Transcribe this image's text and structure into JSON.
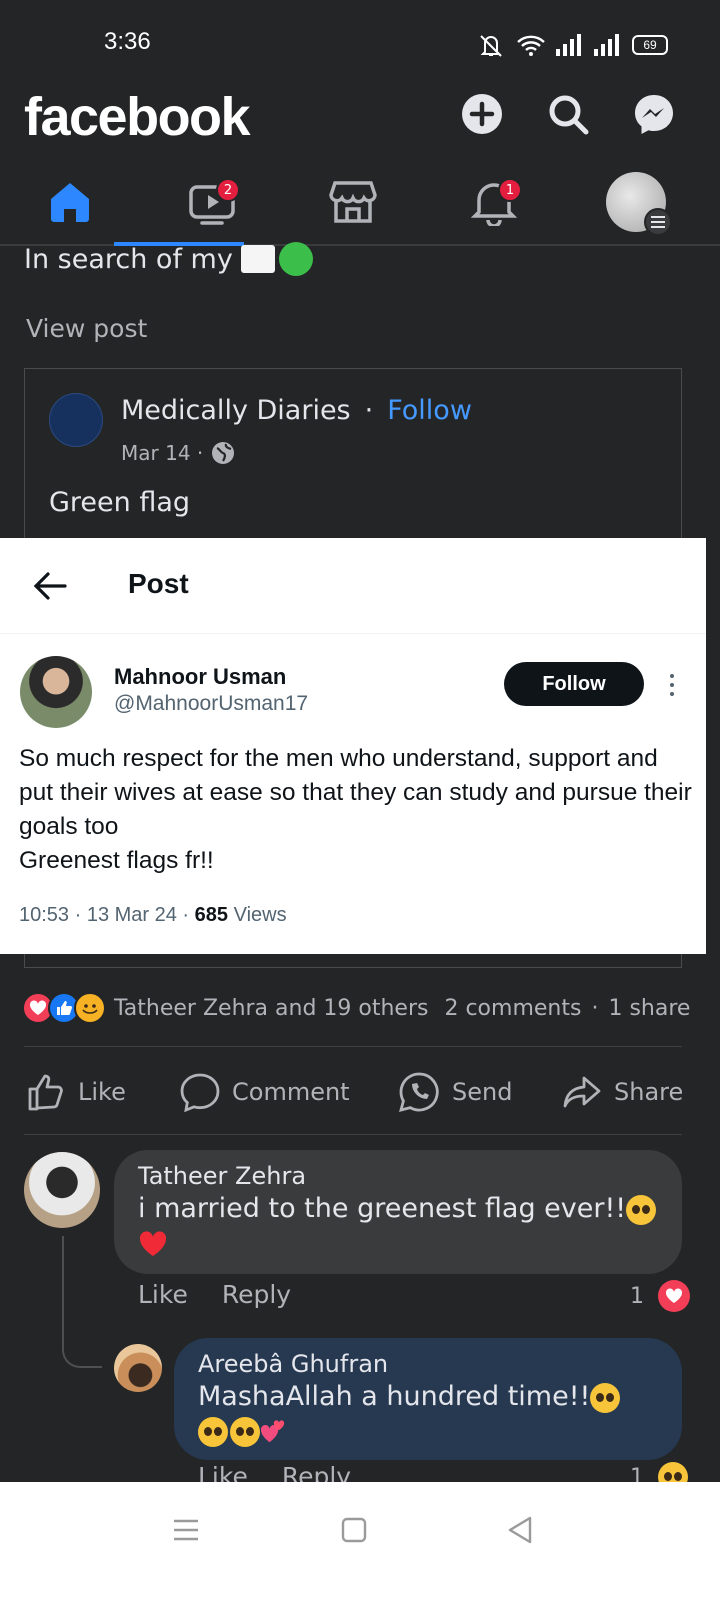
{
  "status_bar": {
    "time": "3:36",
    "battery": "69"
  },
  "header": {
    "logo": "facebook"
  },
  "nav": {
    "video_badge": "2",
    "notifications_badge": "1"
  },
  "post": {
    "text_top": "In search of  my",
    "view_post": "View post",
    "shared": {
      "page_name": "Medically Diaries",
      "separator": "·",
      "follow": "Follow",
      "date": "Mar 14 ·",
      "text": "Green flag"
    }
  },
  "tweet": {
    "topbar_title": "Post",
    "author_name": "Mahnoor Usman",
    "author_handle": "@MahnoorUsman17",
    "follow_label": "Follow",
    "lines": [
      "So much respect for the men who understand, support and put their wives at ease so that they can study and pursue their goals too",
      "Greenest flags fr!!"
    ],
    "meta_prefix": "10:53 · 13 Mar 24 · ",
    "views_count": "685",
    "views_label": " Views"
  },
  "reactions": {
    "names": "Tatheer Zehra and 19 others",
    "comments": "2 comments",
    "sep": "·",
    "shares": "1 share"
  },
  "actions": {
    "like": "Like",
    "comment": "Comment",
    "send": "Send",
    "share": "Share"
  },
  "comments": [
    {
      "name": "Tatheer Zehra",
      "text": "i married to the greenest flag ever!!",
      "like": "Like",
      "reply": "Reply",
      "reaction_count": "1"
    },
    {
      "name": "Areebâ Ghufran",
      "text": "MashaAllah a hundred time!!",
      "like": "Like",
      "reply": "Reply",
      "reaction_count": "1"
    }
  ],
  "colors": {
    "brand": "#2d88ff",
    "badge": "#e41e3f",
    "love": "#f33e58"
  }
}
